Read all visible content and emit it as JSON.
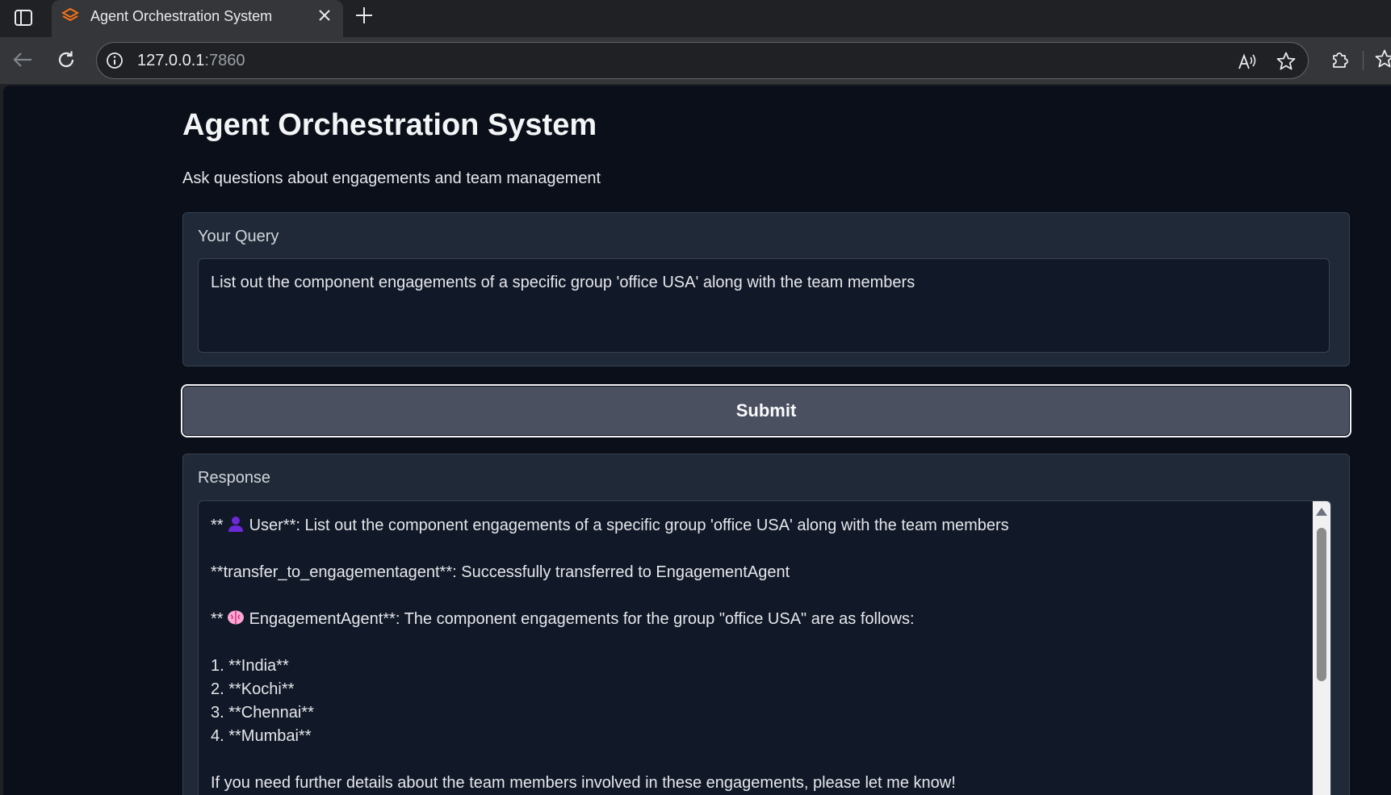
{
  "browser": {
    "tab_title": "Agent Orchestration System",
    "url_host": "127.0.0.1",
    "url_port": ":7860"
  },
  "icons": {
    "sidebar": "sidebar-icon",
    "favicon": "gradio-logo-icon",
    "close": "close-icon",
    "new_tab": "plus-icon",
    "back": "back-arrow-icon",
    "reload": "reload-icon",
    "info": "info-icon",
    "read_aloud": "read-aloud-icon",
    "favorite": "star-icon",
    "extensions": "puzzle-icon",
    "favorites_bar": "star-list-icon"
  },
  "colors": {
    "accent": "#f97316",
    "page_bg": "#0b0f19",
    "block_bg": "#1f2937",
    "button_bg": "#4b5060"
  },
  "app": {
    "title": "Agent Orchestration System",
    "subtitle": "Ask questions about engagements and team management",
    "query_label": "Your Query",
    "query_value": "List out the component engagements of a specific group 'office USA' along with the team members",
    "submit_label": "Submit",
    "response_label": "Response",
    "response": {
      "user_prefix": "**",
      "user_line": "User**: List out the component engagements of a specific group 'office USA' along with the team members",
      "transfer_line": "**transfer_to_engagementagent**: Successfully transferred to EngagementAgent",
      "agent_prefix": "**",
      "agent_line": "EngagementAgent**: The component engagements for the group \"office USA\" are as follows:",
      "items": [
        "1. **India**",
        "2. **Kochi**",
        "3. **Chennai**",
        "4. **Mumbai**"
      ],
      "closing_line": "If you need further details about the team members involved in these engagements, please let me know!"
    }
  }
}
